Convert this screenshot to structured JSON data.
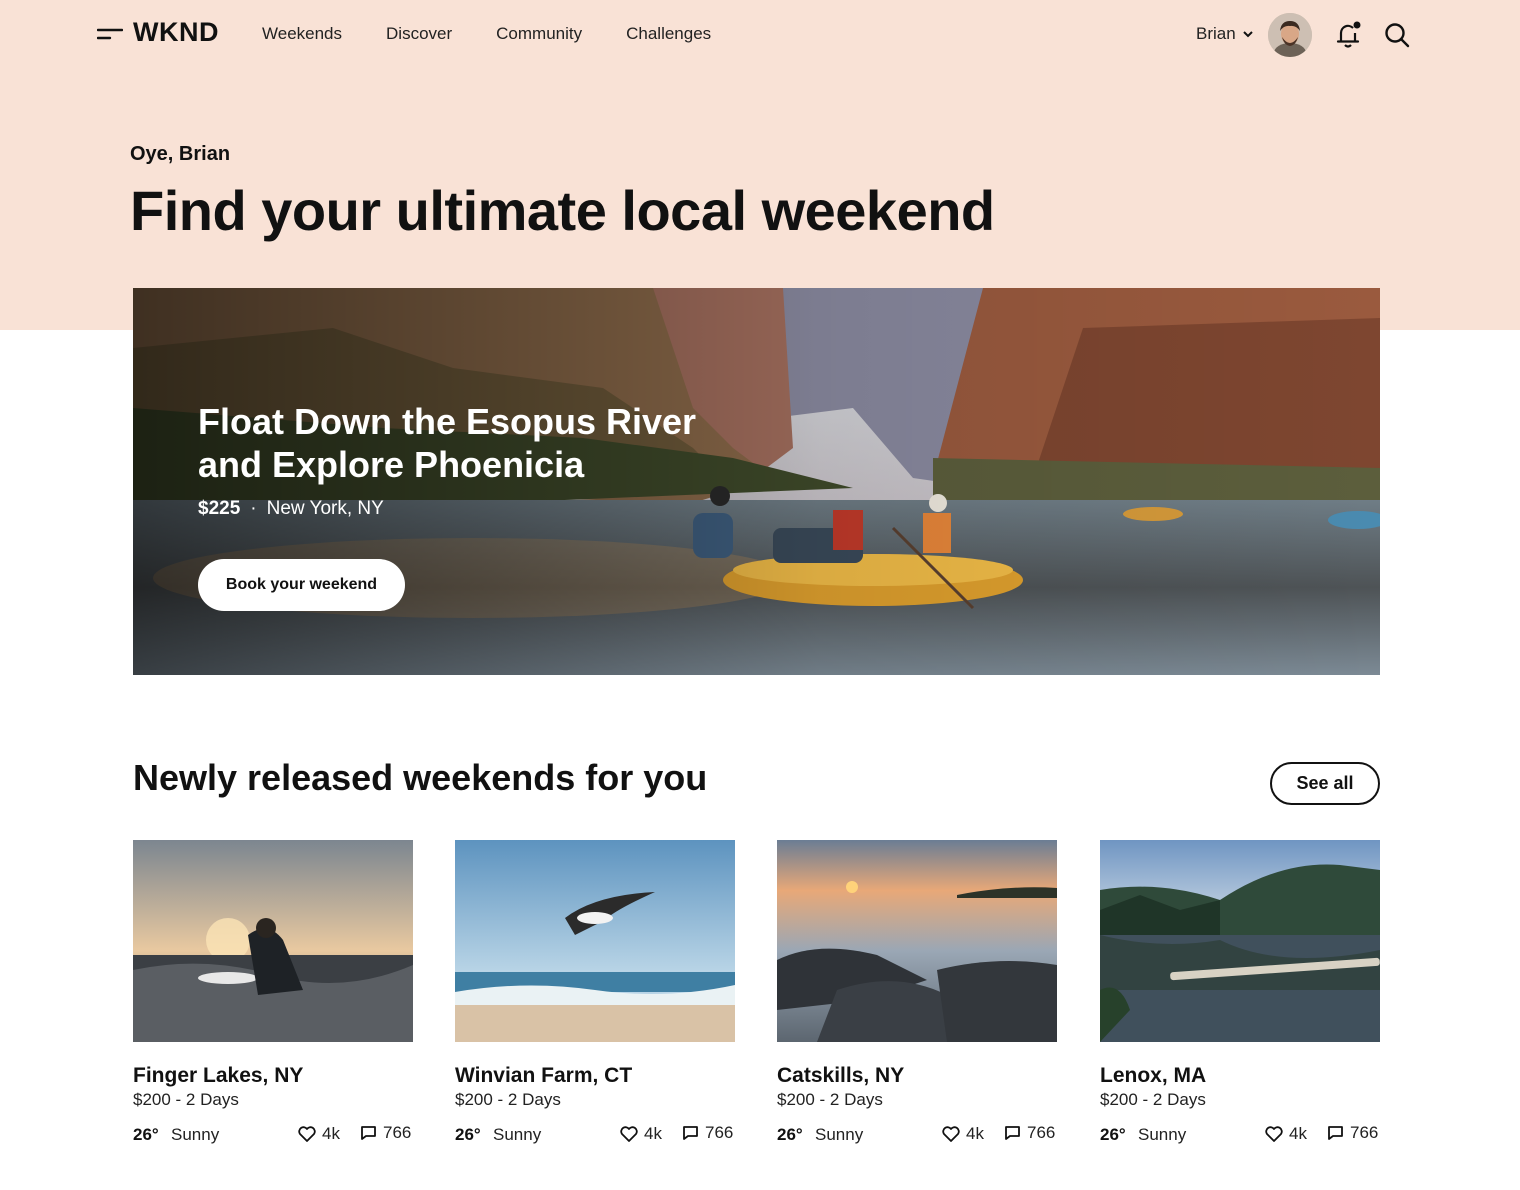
{
  "nav": {
    "logo": "WKND",
    "links": [
      "Weekends",
      "Discover",
      "Community",
      "Challenges"
    ],
    "user_name": "Brian",
    "icons": [
      "menu-icon",
      "chevron-down-icon",
      "avatar",
      "bell-icon",
      "search-icon"
    ]
  },
  "intro": {
    "greeting": "Oye, Brian",
    "headline": "Find your ultimate local weekend"
  },
  "hero": {
    "title": "Float Down the Esopus River and Explore Phoenicia",
    "price": "$225",
    "separator": "·",
    "location": "New York, NY",
    "button_label": "Book your weekend"
  },
  "section": {
    "title": "Newly released weekends for you",
    "see_all_label": "See all"
  },
  "cards": [
    {
      "title": "Finger Lakes, NY",
      "subtitle": "$200 - 2 Days",
      "temp": "26°",
      "weather": "Sunny",
      "likes": "4k",
      "comments": "766"
    },
    {
      "title": "Winvian Farm, CT",
      "subtitle": "$200 - 2 Days",
      "temp": "26°",
      "weather": "Sunny",
      "likes": "4k",
      "comments": "766"
    },
    {
      "title": "Catskills, NY",
      "subtitle": "$200 - 2 Days",
      "temp": "26°",
      "weather": "Sunny",
      "likes": "4k",
      "comments": "766"
    },
    {
      "title": "Lenox, MA",
      "subtitle": "$200 - 2 Days",
      "temp": "26°",
      "weather": "Sunny",
      "likes": "4k",
      "comments": "766"
    }
  ],
  "colors": {
    "hero_band": "#f9e2d6",
    "text": "#111111",
    "notification_dot": "#111111"
  }
}
